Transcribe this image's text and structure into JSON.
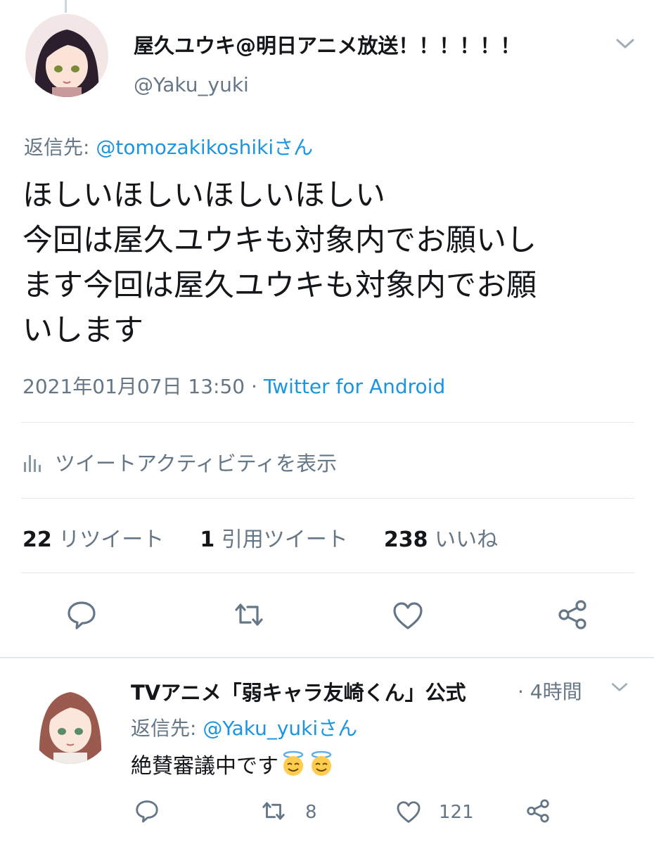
{
  "main_tweet": {
    "display_name": "屋久ユウキ@明日アニメ放送！！！！！！",
    "handle": "@Yaku_yuki",
    "reply_prefix": "返信先: ",
    "reply_mention": "@tomozakikoshikiさん",
    "text": "ほしいほしいほしいほしい\n今回は屋久ユウキも対象内でお願いし\nます今回は屋久ユウキも対象内でお願\nいします",
    "timestamp": "2021年01月07日 13:50",
    "separator": " · ",
    "source": "Twitter for Android",
    "activity_label": "ツイートアクティビティを表示",
    "stats": {
      "retweets": "22",
      "retweets_label": "リツイート",
      "quotes": "1",
      "quotes_label": "引用ツイート",
      "likes": "238",
      "likes_label": "いいね"
    },
    "actions": [
      "reply-icon",
      "retweet-icon",
      "like-icon",
      "share-icon"
    ]
  },
  "reply_tweet": {
    "display_name": "TVアニメ「弱キャラ友崎くん」公式",
    "time": "· 4時間",
    "reply_prefix": "返信先: ",
    "reply_mention": "@Yaku_yukiさん",
    "text": "絶賛審議中です",
    "emojis": [
      "smiling-face-with-halo-icon",
      "smiling-face-with-halo-icon"
    ],
    "retweet_count": "8",
    "like_count": "121"
  },
  "colors": {
    "link": "#1b95e0",
    "secondary_text": "#657786",
    "primary_text": "#14171a",
    "divider": "#e1e8ed"
  }
}
